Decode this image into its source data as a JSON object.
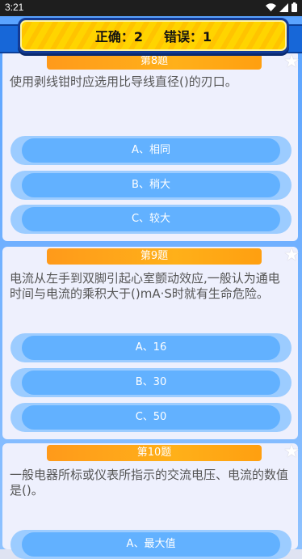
{
  "status": {
    "time": "3:21"
  },
  "score": {
    "correct_label": "正确：2",
    "wrong_label": "错误：1"
  },
  "questions": [
    {
      "header": "第8题",
      "text": "使用剥线钳时应选用比导线直径()的刃口。",
      "options": [
        "A、相同",
        "B、稍大",
        "C、较大"
      ]
    },
    {
      "header": "第9题",
      "text": "电流从左手到双脚引起心室颤动效应,一般认为通电时间与电流的乘积大于()mA·S时就有生命危险。",
      "options": [
        "A、16",
        "B、30",
        "C、50"
      ]
    },
    {
      "header": "第10题",
      "text": "一般电器所标或仪表所指示的交流电压、电流的数值是()。",
      "options": [
        "A、最大值"
      ]
    }
  ],
  "colors": {
    "accent_blue": "#1767d8",
    "option_blue": "#62b1ff",
    "header_orange": "#ffa51a",
    "score_yellow": "#ffd400"
  },
  "icons": [
    "wifi-icon",
    "signal-icon",
    "battery-icon",
    "star-icon"
  ]
}
